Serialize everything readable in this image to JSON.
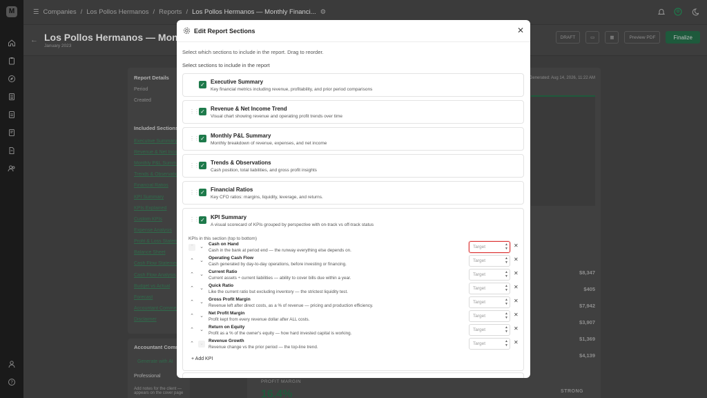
{
  "rail": {
    "logo": "M",
    "icons": [
      "home-icon",
      "clipboard-icon",
      "compass-icon",
      "calculator-icon",
      "document-icon",
      "report-icon",
      "file-icon",
      "users-icon"
    ],
    "bottom_icons": [
      "user-icon",
      "help-icon"
    ]
  },
  "breadcrumb": {
    "items": [
      "Companies",
      "Los Pollos Hermanos",
      "Reports",
      "Los Pollos Hermanos — Monthly Financi..."
    ],
    "sep": "/"
  },
  "page": {
    "title": "Los Pollos Hermanos — Monthly Financial",
    "subtitle": "January 2023",
    "draft": "DRAFT",
    "preview": "Preview PDF",
    "finalize": "Finalize"
  },
  "left_panel": {
    "details_title": "Report Details",
    "period_label": "Period",
    "created_label": "Created",
    "included_title": "Included Sections",
    "links": [
      "Executive Summary",
      "Revenue & Net Income",
      "Monthly P&L Summary",
      "Trends & Observations",
      "Financial Ratios",
      "KPI Summary",
      "KPIs Explained",
      "Custom KPIs",
      "Expense Analysis",
      "Profit & Loss Statement",
      "Balance Sheet",
      "Cash Flow Statement",
      "Cash Flow Analysis",
      "Budget vs Actual",
      "Forecast",
      "Accountant Commentary",
      "Disclaimer"
    ]
  },
  "left_panel2": {
    "title": "Accountant Commentary",
    "gen": "Generate with AI",
    "tab": "Professional",
    "hint": "Add notes for the client — appears on the cover page"
  },
  "right_panel": {
    "generated": "Generated: Aug 14, 2026, 11:22 AM",
    "values": [
      "$8,347",
      "$405",
      "$7,942",
      "$3,907",
      "$1,369",
      "$4,139"
    ]
  },
  "bottom_panel": {
    "label": "PROFIT MARGIN",
    "value": "16.4%",
    "status": "STRONG"
  },
  "modal": {
    "title": "Edit Report Sections",
    "intro": "Select which sections to include in the report. Drag to reorder.",
    "select_label": "Select sections to include in the report",
    "sections": [
      {
        "title": "Executive Summary",
        "desc": "Key financial metrics including revenue, profitability, and prior period comparisons",
        "checked": true
      },
      {
        "title": "Revenue & Net Income Trend",
        "desc": "Visual chart showing revenue and operating profit trends over time",
        "checked": true
      },
      {
        "title": "Monthly P&L Summary",
        "desc": "Monthly breakdown of revenue, expenses, and net income",
        "checked": true
      },
      {
        "title": "Trends & Observations",
        "desc": "Cash position, total liabilities, and gross profit insights",
        "checked": true
      },
      {
        "title": "Financial Ratios",
        "desc": "Key CFO ratios: margins, liquidity, leverage, and returns.",
        "checked": true
      }
    ],
    "kpi_section": {
      "title": "KPI Summary",
      "desc": "A visual scorecard of KPIs grouped by perspective with on-track vs off-track status",
      "list_header": "KPIs in this section (top to bottom)",
      "target_placeholder": "Target",
      "add_label": "Add KPI",
      "kpis": [
        {
          "name": "Cash on Hand",
          "desc": "Cash in the bank at period end — the runway everything else depends on."
        },
        {
          "name": "Operating Cash Flow",
          "desc": "Cash generated by day-to-day operations, before investing or financing."
        },
        {
          "name": "Current Ratio",
          "desc": "Current assets ÷ current liabilities — ability to cover bills due within a year."
        },
        {
          "name": "Quick Ratio",
          "desc": "Like the current ratio but excluding inventory — the strictest liquidity test."
        },
        {
          "name": "Gross Profit Margin",
          "desc": "Revenue left after direct costs, as a % of revenue — pricing and production efficiency."
        },
        {
          "name": "Net Profit Margin",
          "desc": "Profit kept from every revenue dollar after ALL costs."
        },
        {
          "name": "Return on Equity",
          "desc": "Profit as a % of the owner's equity — how hard invested capital is working."
        },
        {
          "name": "Revenue Growth",
          "desc": "Revenue change vs the prior period — the top-line trend."
        }
      ]
    }
  },
  "colors": {
    "accent": "#1e7a4b",
    "highlight": "#d33333",
    "overlay": "#3a3a3a"
  }
}
